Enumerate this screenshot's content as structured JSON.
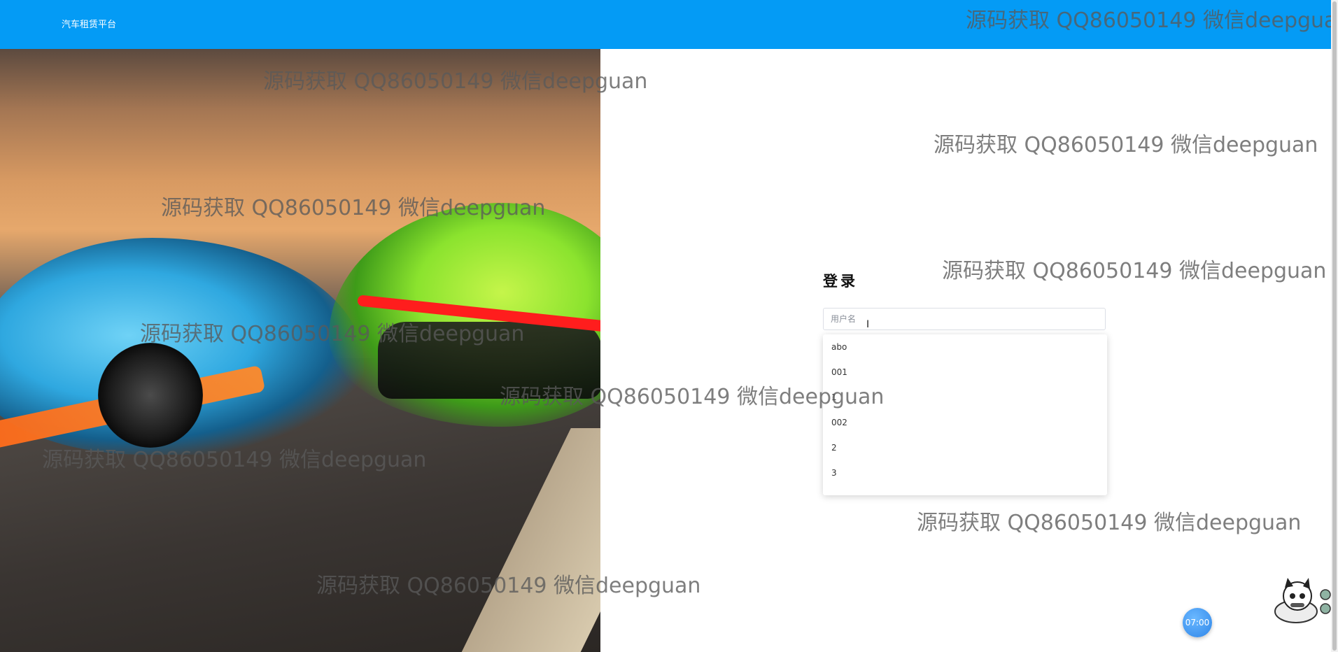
{
  "header": {
    "brand": "汽车租赁平台"
  },
  "login": {
    "title": "登录",
    "username_placeholder": "用户名",
    "username_value": ""
  },
  "autocomplete": {
    "items": [
      "abo",
      "001",
      "1",
      "002",
      "2",
      "3"
    ]
  },
  "watermark": "源码获取 QQ86050149 微信deepguan",
  "widgets": {
    "time": "07:00"
  }
}
